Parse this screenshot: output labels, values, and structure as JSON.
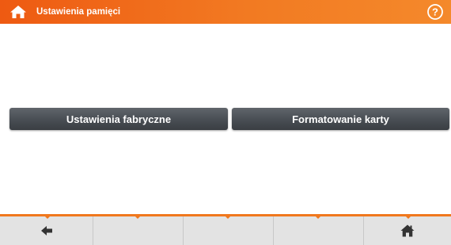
{
  "header": {
    "title": "Ustawienia pamięci",
    "home_icon": "home-icon",
    "help_icon": "help-icon",
    "help_glyph": "?"
  },
  "main": {
    "factory_button_label": "Ustawienia fabryczne",
    "format_button_label": "Formatowanie karty"
  },
  "footer": {
    "back_icon": "back-arrow-icon",
    "home_icon": "home-icon"
  },
  "colors": {
    "accent": "#f0781e",
    "button": "#4a4f55",
    "footer": "#e3e3e3"
  }
}
